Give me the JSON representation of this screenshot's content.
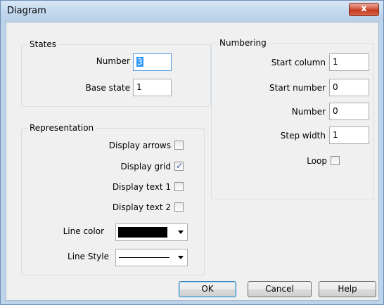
{
  "window": {
    "title": "Diagram",
    "close_label": "x"
  },
  "states": {
    "title": "States",
    "number_label": "Number",
    "number_value": "3",
    "base_state_label": "Base state",
    "base_state_value": "1"
  },
  "representation": {
    "title": "Representation",
    "display_arrows_label": "Display arrows",
    "display_arrows_checked": false,
    "display_grid_label": "Display grid",
    "display_grid_checked": true,
    "display_grid_mark": "✓",
    "display_text1_label": "Display text 1",
    "display_text1_checked": false,
    "display_text2_label": "Display text 2",
    "display_text2_checked": false,
    "line_color_label": "Line color",
    "line_color_value": "#000000",
    "line_style_label": "Line Style",
    "line_style_value": "solid"
  },
  "numbering": {
    "title": "Numbering",
    "start_column_label": "Start column",
    "start_column_value": "1",
    "start_number_label": "Start number",
    "start_number_value": "0",
    "number_label": "Number",
    "number_value": "0",
    "step_width_label": "Step width",
    "step_width_value": "1",
    "loop_label": "Loop",
    "loop_checked": false
  },
  "buttons": {
    "ok": "OK",
    "cancel": "Cancel",
    "help": "Help"
  }
}
